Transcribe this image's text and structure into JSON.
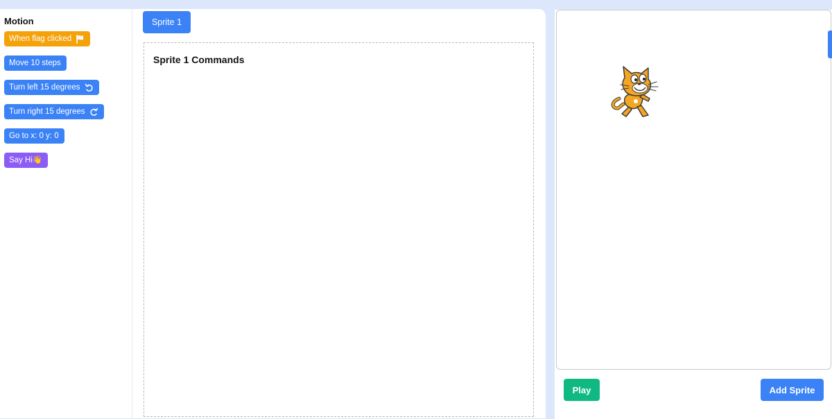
{
  "palette": {
    "title": "Motion",
    "blocks": [
      {
        "label": "When flag clicked",
        "icon": "flag-icon",
        "color": "#f5a20a"
      },
      {
        "label": "Move 10 steps",
        "color": "#3b82f6"
      },
      {
        "label": "Turn left 15 degrees",
        "icon": "rotate-left-icon",
        "color": "#3b82f6"
      },
      {
        "label": "Turn right 15 degrees",
        "icon": "rotate-right-icon",
        "color": "#3b82f6"
      },
      {
        "label": "Go to x: 0 y: 0",
        "color": "#3b82f6"
      },
      {
        "label": "Say Hi👋",
        "color": "#8b5cf6"
      }
    ]
  },
  "editor": {
    "tab_label": "Sprite 1",
    "commands_title": "Sprite 1 Commands"
  },
  "stage": {
    "sprite_icon": "scratch-cat-icon",
    "play_label": "Play",
    "add_sprite_label": "Add Sprite"
  },
  "colors": {
    "accent_blue": "#3b82f6",
    "event_orange": "#f5a20a",
    "looks_purple": "#8b5cf6",
    "play_green": "#10b981",
    "background": "#dde7fb"
  }
}
